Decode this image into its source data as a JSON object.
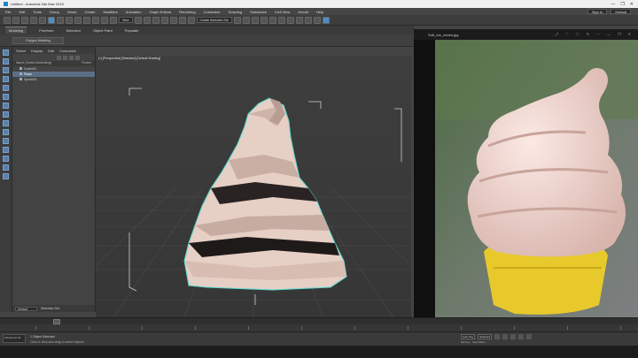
{
  "window": {
    "title": "Untitled - Autodesk 3ds Max 2019",
    "controls": [
      "—",
      "❐",
      "✕"
    ]
  },
  "menubar": {
    "items": [
      "File",
      "Edit",
      "Tools",
      "Group",
      "Views",
      "Create",
      "Modifiers",
      "Animation",
      "Graph Editors",
      "Rendering",
      "Customize",
      "Scripting",
      "Substance",
      "Civil View",
      "Arnold",
      "Help"
    ],
    "workspace_label": "Default",
    "signin_label": "Sign In"
  },
  "toolbar": {
    "view_dropdown": "View",
    "selection_set": "Create Selection Set",
    "workspace_dd": "Default"
  },
  "ribbon": {
    "tabs": [
      "Modeling",
      "Freeform",
      "Selection",
      "Object Paint",
      "Populate"
    ],
    "active": "Modeling",
    "group_label": "Polygon Modeling"
  },
  "explorer": {
    "tabs": [
      "Select",
      "Display",
      "Edit",
      "Customize"
    ],
    "header_name": "Name (Sorted Ascending)",
    "header_frozen": "Frozen",
    "rows": [
      {
        "label": "Cone001",
        "selected": false
      },
      {
        "label": "Plane",
        "selected": true
      },
      {
        "label": "Spiral001",
        "selected": false
      }
    ],
    "layer_dd": "Default",
    "selection_set_label": "Selection Set:"
  },
  "viewport": {
    "label": "[+] [Perspective] [Standard] [Default Shading]",
    "tabs": []
  },
  "reference_window": {
    "title": "Soft_Ice_cream.jpg",
    "icons": [
      "⤢",
      "♡",
      "ⓘ",
      "✎",
      "⋯",
      "—",
      "❐",
      "✕"
    ]
  },
  "timeline": {
    "frame_label": "0 / 100"
  },
  "status": {
    "maxscript": "MAXScript Mi",
    "line1": "1 Object Selected",
    "line2": "Click or click-and-drag to select objects",
    "auto_key": "Auto Key",
    "set_key": "Set Key",
    "selected_dd": "Selected",
    "key_filters": "Key Filters..."
  },
  "colors": {
    "selection_outline": "#54d8d0",
    "ice_cream": "#e8cfc6",
    "cone": "#e9c92e",
    "accent": "#4a8fc7"
  }
}
